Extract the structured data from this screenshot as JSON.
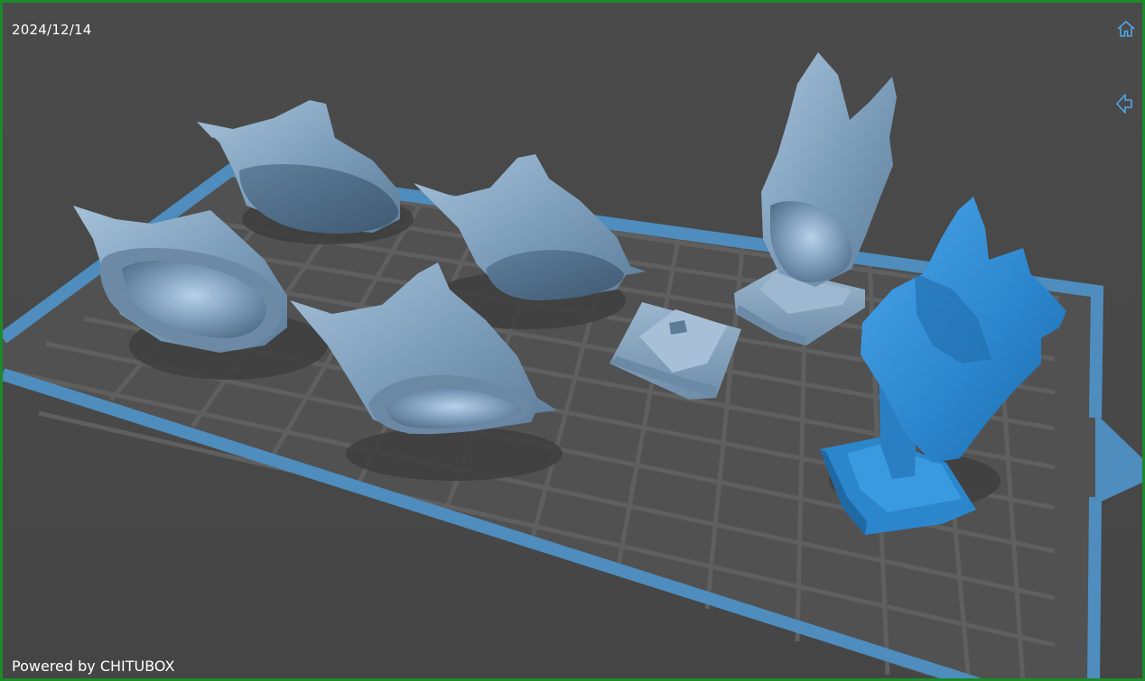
{
  "viewport": {
    "date": "2024/12/14",
    "powered_by": "Powered by CHITUBOX"
  },
  "controls": {
    "home_icon": "home-icon",
    "back_icon": "arrow-left-icon"
  },
  "colors": {
    "frame_border": "#1c8a2a",
    "background": "#4b4b4b",
    "plate_border": "#4e8dbd",
    "grid_line": "#5e5e5e",
    "model_default": "#7d9fbd",
    "model_selected": "#2f8fd6"
  },
  "scene": {
    "models": [
      {
        "name": "dog-bust-lying-1",
        "state": "default"
      },
      {
        "name": "dog-bust-lying-2",
        "state": "default"
      },
      {
        "name": "dog-bust-lying-3",
        "state": "default"
      },
      {
        "name": "dog-bust-lying-4",
        "state": "default"
      },
      {
        "name": "dog-bust-standing",
        "state": "default"
      },
      {
        "name": "pedestal-base",
        "state": "default"
      },
      {
        "name": "dog-bust-selected",
        "state": "selected"
      }
    ]
  }
}
